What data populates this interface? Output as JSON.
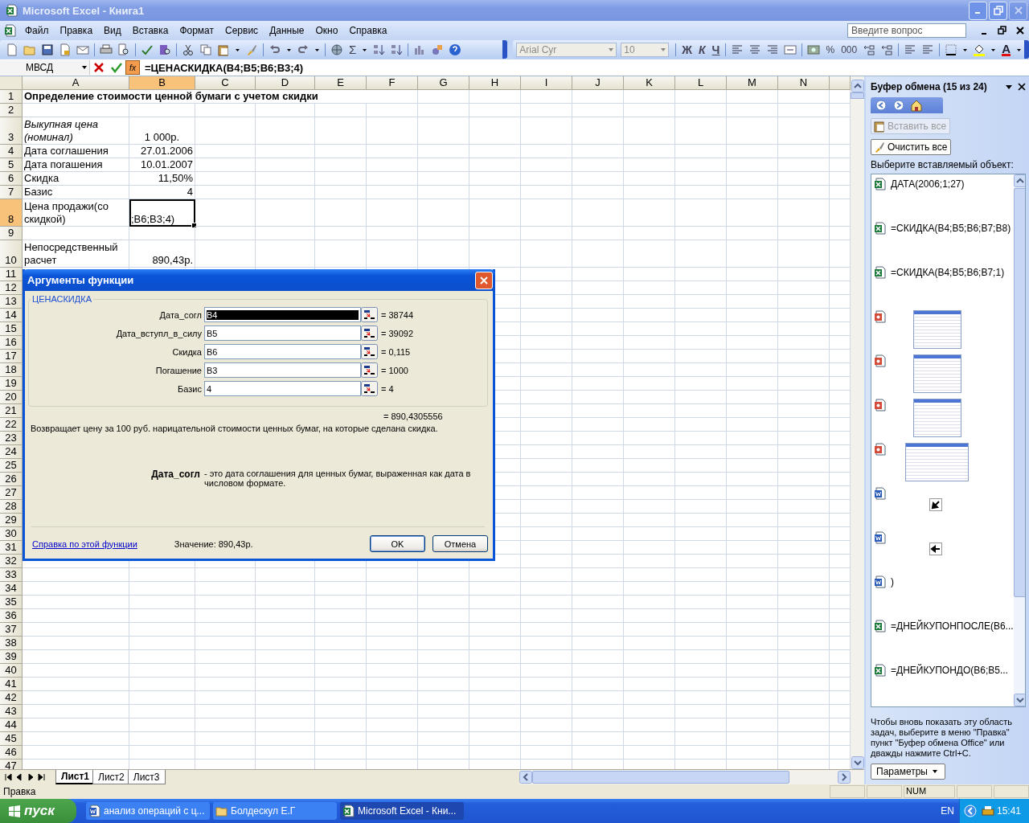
{
  "window": {
    "title": "Microsoft Excel - Книга1"
  },
  "menu": [
    "Файл",
    "Правка",
    "Вид",
    "Вставка",
    "Формат",
    "Сервис",
    "Данные",
    "Окно",
    "Справка"
  ],
  "help_search": {
    "placeholder": "Введите вопрос"
  },
  "toolbar": {
    "sum": "Σ",
    "font": "Arial Cyr",
    "size": "10",
    "bold": "Ж",
    "italic": "К",
    "underline": "Ч",
    "percent": "%",
    "thousands": "000",
    "font_color": "A"
  },
  "formula_bar": {
    "name_box": "МВСД",
    "function_button": "fx",
    "formula": "=ЦЕНАСКИДКА(B4;B5;B6;B3;4)"
  },
  "sheet": {
    "columns": [
      {
        "label": "A",
        "selected": false
      },
      {
        "label": "B",
        "selected": true
      },
      {
        "label": "C",
        "selected": false
      },
      {
        "label": "D",
        "selected": false
      },
      {
        "label": "E",
        "selected": false
      },
      {
        "label": "F",
        "selected": false
      },
      {
        "label": "G",
        "selected": false
      },
      {
        "label": "H",
        "selected": false
      },
      {
        "label": "I",
        "selected": false
      },
      {
        "label": "J",
        "selected": false
      },
      {
        "label": "K",
        "selected": false
      },
      {
        "label": "L",
        "selected": false
      },
      {
        "label": "M",
        "selected": false
      },
      {
        "label": "N",
        "selected": false
      }
    ],
    "rows": [
      {
        "number": "1",
        "selected": false,
        "wrap": false,
        "a": {
          "text": "Определение стоимости ценной бумаги с учетом скидки",
          "bold": true,
          "italic": false,
          "selected": false
        }
      },
      {
        "number": "2",
        "selected": false
      },
      {
        "number": "3",
        "selected": false,
        "wrap": true,
        "a": {
          "text": "Выкупная цена (номинал)",
          "bold": false,
          "italic": true,
          "selected": false
        },
        "b": {
          "text": "1 000р.",
          "kind": "centered",
          "bold": false,
          "italic": false,
          "selected": false
        }
      },
      {
        "number": "4",
        "selected": false,
        "wrap": false,
        "a": {
          "text": "Дата соглашения",
          "bold": false,
          "italic": false,
          "selected": false
        },
        "b": {
          "text": "27.01.2006",
          "kind": "number",
          "bold": false,
          "italic": false,
          "selected": false
        }
      },
      {
        "number": "5",
        "selected": false,
        "wrap": false,
        "a": {
          "text": "Дата погашения",
          "bold": false,
          "italic": false,
          "selected": false
        },
        "b": {
          "text": "10.01.2007",
          "kind": "number",
          "bold": false,
          "italic": false,
          "selected": false
        }
      },
      {
        "number": "6",
        "selected": false,
        "wrap": false,
        "a": {
          "text": "Скидка",
          "bold": false,
          "italic": false,
          "selected": false
        },
        "b": {
          "text": "11,50%",
          "kind": "number",
          "bold": false,
          "italic": false,
          "selected": false
        }
      },
      {
        "number": "7",
        "selected": false,
        "wrap": false,
        "a": {
          "text": "Базис",
          "bold": false,
          "italic": false,
          "selected": false
        },
        "b": {
          "text": "4",
          "kind": "number",
          "bold": false,
          "italic": false,
          "selected": false
        }
      },
      {
        "number": "8",
        "selected": true,
        "wrap": true,
        "a": {
          "text": "Цена продажи(со скидкой)",
          "bold": false,
          "italic": false,
          "selected": false
        },
        "b": {
          "text": ";B6;B3;4)",
          "kind": "text",
          "bold": false,
          "italic": false,
          "selected": true
        }
      },
      {
        "number": "9",
        "selected": false
      },
      {
        "number": "10",
        "selected": false,
        "wrap": true,
        "a": {
          "text": "Непосредственный расчет",
          "bold": false,
          "italic": false,
          "selected": false
        },
        "b": {
          "text": "890,43р.",
          "kind": "number",
          "bold": false,
          "italic": false,
          "selected": false
        }
      },
      {
        "number": "11",
        "selected": false
      },
      {
        "number": "12",
        "selected": false
      },
      {
        "number": "13",
        "selected": false
      },
      {
        "number": "14",
        "selected": false
      },
      {
        "number": "15",
        "selected": false
      },
      {
        "number": "16",
        "selected": false
      },
      {
        "number": "17",
        "selected": false
      },
      {
        "number": "18",
        "selected": false
      },
      {
        "number": "19",
        "selected": false
      },
      {
        "number": "20",
        "selected": false
      },
      {
        "number": "21",
        "selected": false
      },
      {
        "number": "22",
        "selected": false
      },
      {
        "number": "23",
        "selected": false
      },
      {
        "number": "24",
        "selected": false
      },
      {
        "number": "25",
        "selected": false
      },
      {
        "number": "26",
        "selected": false
      },
      {
        "number": "27",
        "selected": false
      },
      {
        "number": "28",
        "selected": false
      },
      {
        "number": "29",
        "selected": false
      },
      {
        "number": "30",
        "selected": false
      },
      {
        "number": "31",
        "selected": false
      },
      {
        "number": "32",
        "selected": false
      },
      {
        "number": "33",
        "selected": false
      },
      {
        "number": "34",
        "selected": false
      },
      {
        "number": "35",
        "selected": false
      },
      {
        "number": "36",
        "selected": false
      },
      {
        "number": "37",
        "selected": false
      },
      {
        "number": "38",
        "selected": false
      },
      {
        "number": "39",
        "selected": false
      },
      {
        "number": "40",
        "selected": false
      },
      {
        "number": "41",
        "selected": false
      },
      {
        "number": "42",
        "selected": false
      },
      {
        "number": "43",
        "selected": false
      },
      {
        "number": "44",
        "selected": false
      },
      {
        "number": "45",
        "selected": false
      },
      {
        "number": "46",
        "selected": false
      },
      {
        "number": "47",
        "selected": false
      }
    ]
  },
  "sheet_tabs": [
    {
      "label": "Лист1",
      "selected": true
    },
    {
      "label": "Лист2",
      "selected": false
    },
    {
      "label": "Лист3",
      "selected": false
    }
  ],
  "dialog": {
    "title": "Аргументы функции",
    "function_name": "ЦЕНАСКИДКА",
    "arguments": [
      {
        "label": "Дата_согл",
        "value": "B4",
        "result": "= 38744",
        "selected": true
      },
      {
        "label": "Дата_вступл_в_силу",
        "value": "B5",
        "result": "= 39092",
        "selected": false
      },
      {
        "label": "Скидка",
        "value": "B6",
        "result": "= 0,115",
        "selected": false
      },
      {
        "label": "Погашение",
        "value": "B3",
        "result": "= 1000",
        "selected": false
      },
      {
        "label": "Базис",
        "value": "4",
        "result": "= 4",
        "selected": false
      }
    ],
    "result": "= 890,4305556",
    "description": "Возвращает цену за 100 руб. нарицательной стоимости ценных бумаг, на которые сделана скидка.",
    "argument_help": {
      "name": "Дата_согл",
      "text": "- это дата соглашения для ценных бумаг, выраженная как дата в числовом формате."
    },
    "help_link": "Справка по этой функции",
    "value": "Значение: 890,43р.",
    "buttons": [
      {
        "label": "OK",
        "default": true
      },
      {
        "label": "Отмена",
        "default": false
      }
    ]
  },
  "task_pane": {
    "title": "Буфер обмена (15 из 24)",
    "buttons": [
      {
        "label": "Вставить все",
        "disabled": true
      },
      {
        "label": "Очистить все",
        "disabled": false
      }
    ],
    "prompt": "Выберите вставляемый объект:",
    "items": [
      {
        "kind": "text",
        "text": "ДАТА(2006;1;27)"
      },
      {
        "kind": "text",
        "text": "=СКИДКА(B4;B5;B6;B7;B8)"
      },
      {
        "kind": "text",
        "text": "=СКИДКА(B4;B5;B6;B7;1)"
      },
      {
        "kind": "screenshot"
      },
      {
        "kind": "screenshot"
      },
      {
        "kind": "screenshot"
      },
      {
        "kind": "screenshot"
      },
      {
        "kind": "arrow"
      },
      {
        "kind": "arrow"
      },
      {
        "kind": "text",
        "text": ")"
      },
      {
        "kind": "text",
        "text": "=ДНЕЙКУПОНПОСЛЕ(B6..."
      },
      {
        "kind": "text",
        "text": "=ДНЕЙКУПОНДО(B6;B5..."
      }
    ],
    "note": "Чтобы вновь показать эту область задач, выберите в меню \"Правка\" пункт \"Буфер обмена Office\" или дважды нажмите Ctrl+C.",
    "options_button": "Параметры"
  },
  "status_bar": {
    "mode": "Правка",
    "num": "NUM"
  },
  "taskbar": {
    "start": "пуск",
    "tasks": [
      {
        "label": "анализ операций с ц...",
        "selected": false
      },
      {
        "label": "Болдескул Е.Г",
        "selected": false
      },
      {
        "label": "Microsoft Excel - Кни...",
        "selected": true
      }
    ],
    "language": "EN",
    "clock": "15:41"
  }
}
